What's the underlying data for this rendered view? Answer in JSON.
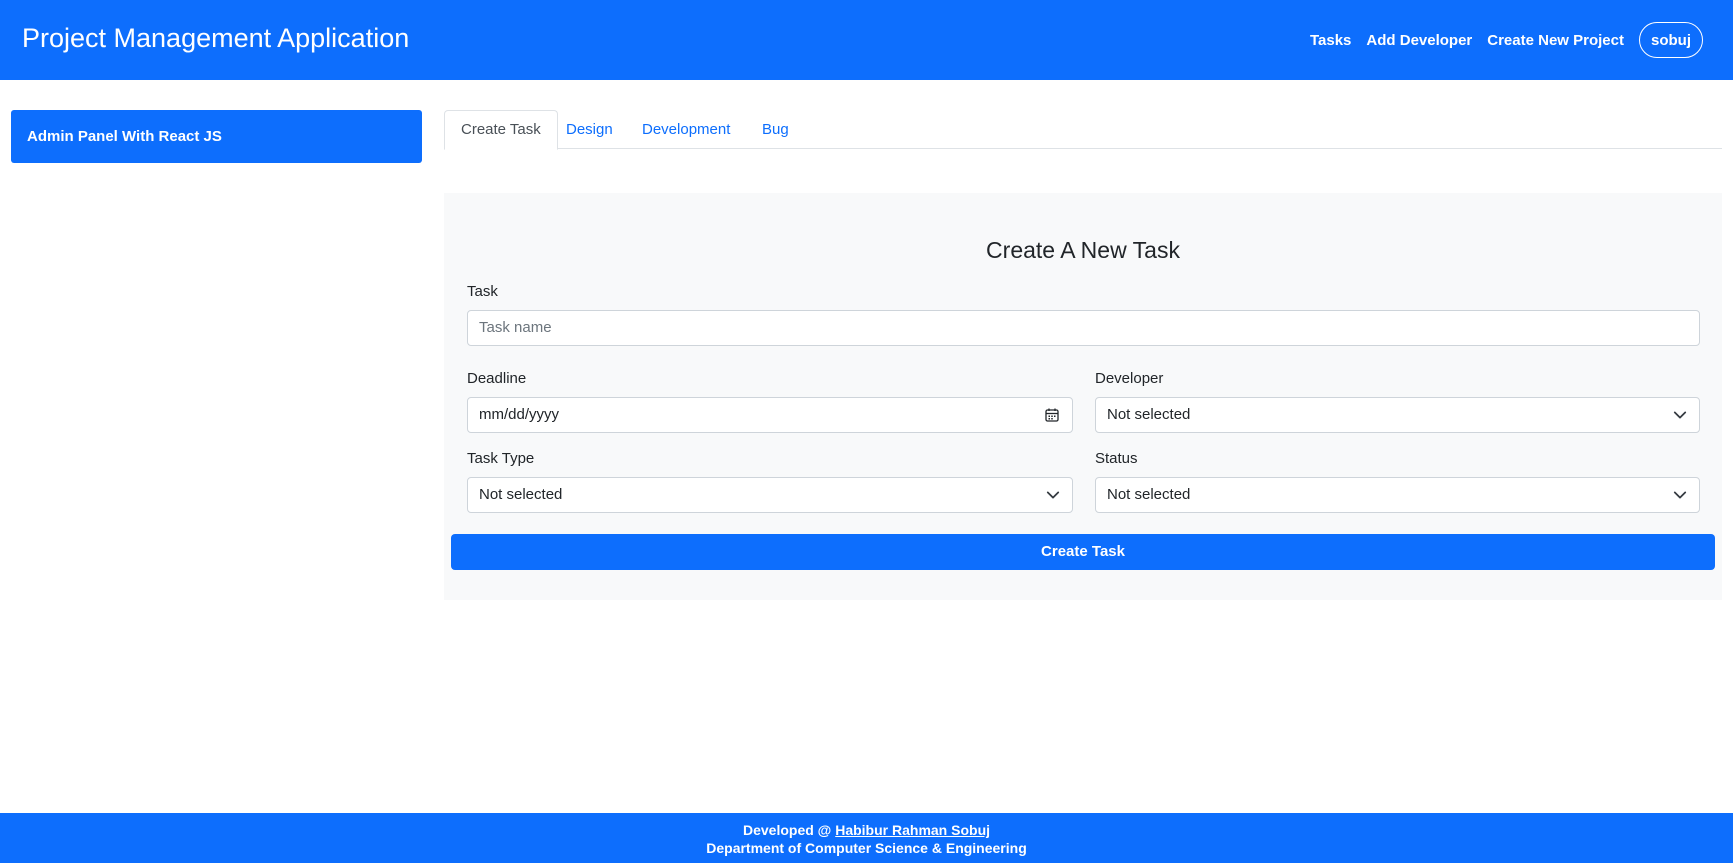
{
  "header": {
    "brand": "Project Management Application",
    "nav": [
      "Tasks",
      "Add Developer",
      "Create New Project"
    ],
    "user": "sobuj"
  },
  "sidebar": {
    "title": "Admin Panel With React JS"
  },
  "tabs": [
    "Create Task",
    "Design",
    "Development",
    "Bug"
  ],
  "form": {
    "title": "Create A New Task",
    "task_label": "Task",
    "task_placeholder": "Task name",
    "deadline_label": "Deadline",
    "deadline_placeholder": "mm/dd/yyyy",
    "developer_label": "Developer",
    "developer_value": "Not selected",
    "task_type_label": "Task Type",
    "task_type_value": "Not selected",
    "status_label": "Status",
    "status_value": "Not selected",
    "submit_label": "Create Task"
  },
  "footer": {
    "prefix": "Developed @ ",
    "author": "Habibur Rahman Sobuj",
    "department": "Department of Computer Science & Engineering"
  },
  "colors": {
    "primary": "#0d6efd",
    "panel_bg": "#f8f9fa",
    "border": "#ced4da"
  },
  "icons": [
    "calendar-icon",
    "chevron-down-icon"
  ]
}
